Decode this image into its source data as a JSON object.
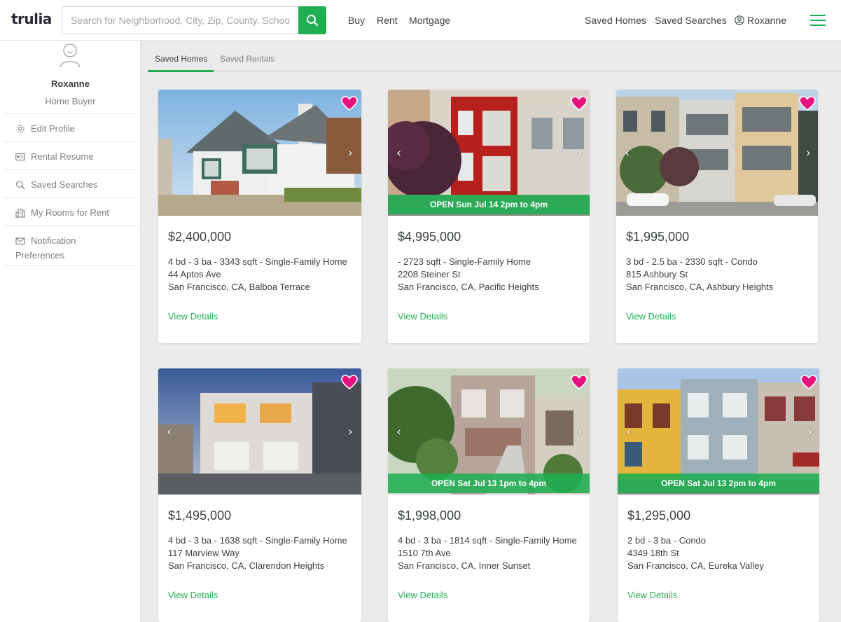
{
  "header": {
    "logo": "trulia",
    "search_placeholder": "Search for Neighborhood, City, Zip, County, School",
    "nav": [
      "Buy",
      "Rent",
      "Mortgage"
    ],
    "saved_homes": "Saved Homes",
    "saved_searches": "Saved Searches",
    "user": "Roxanne"
  },
  "sidebar": {
    "name": "Roxanne",
    "role": "Home Buyer",
    "items": [
      {
        "label": "Edit Profile",
        "icon": "gear-icon"
      },
      {
        "label": "Rental Resume",
        "icon": "id-card-icon"
      },
      {
        "label": "Saved Searches",
        "icon": "search-icon"
      },
      {
        "label": "My Rooms for Rent",
        "icon": "building-icon"
      },
      {
        "label": "Notification Preferences",
        "icon": "envelope-icon"
      }
    ]
  },
  "tabs": [
    "Saved Homes",
    "Saved Rentals"
  ],
  "colors": {
    "accent": "#1fae52",
    "heart": "#e8127c",
    "text": "#3b4144"
  },
  "listings": [
    {
      "price": "$2,400,000",
      "specs": "4 bd - 3 ba - 3343 sqft - Single-Family Home",
      "street": "44 Aptos Ave",
      "city": "San Francisco, CA, Balboa Terrace",
      "open": "",
      "link": "View Details"
    },
    {
      "price": "$4,995,000",
      "specs": "- 2723 sqft - Single-Family Home",
      "street": "2208 Steiner St",
      "city": "San Francisco, CA, Pacific Heights",
      "open": "OPEN Sun Jul 14 2pm to 4pm",
      "link": "View Details"
    },
    {
      "price": "$1,995,000",
      "specs": "3 bd - 2.5 ba - 2330 sqft - Condo",
      "street": "815 Ashbury St",
      "city": "San Francisco, CA, Ashbury Heights",
      "open": "",
      "link": "View Details"
    },
    {
      "price": "$1,495,000",
      "specs": "4 bd - 3 ba - 1638 sqft - Single-Family Home",
      "street": "117 Marview Way",
      "city": "San Francisco, CA, Clarendon Heights",
      "open": "",
      "link": "View Details"
    },
    {
      "price": "$1,998,000",
      "specs": "4 bd - 3 ba - 1814 sqft - Single-Family Home",
      "street": "1510 7th Ave",
      "city": "San Francisco, CA, Inner Sunset",
      "open": "OPEN Sat Jul 13 1pm to 4pm",
      "link": "View Details"
    },
    {
      "price": "$1,295,000",
      "specs": "2 bd - 3 ba - Condo",
      "street": "4349 18th St",
      "city": "San Francisco, CA, Eureka Valley",
      "open": "OPEN Sat Jul 13 2pm to 4pm",
      "link": "View Details"
    }
  ]
}
